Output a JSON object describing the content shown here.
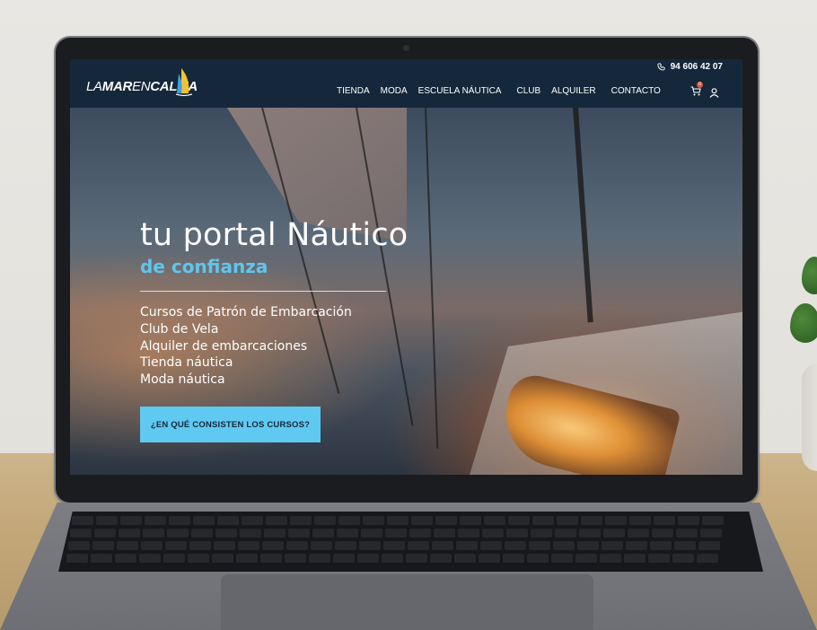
{
  "header": {
    "logo": {
      "part1": "LA",
      "part2": "MAR",
      "part3": "EN",
      "part4": "CALMA"
    },
    "phone": "94 606 42 07",
    "nav": [
      "TIENDA",
      "MODA",
      "ESCUELA NÁUTICA",
      "CLUB",
      "ALQUILER",
      "CONTACTO"
    ],
    "cart_count": "0",
    "icons": {
      "phone": "phone-icon",
      "cart": "cart-icon",
      "user": "user-icon"
    }
  },
  "hero": {
    "title_part1": "tu portal",
    "title_part2": "Náutico",
    "subtitle": "de confianza",
    "services": [
      "Cursos de Patrón de Embarcación",
      "Club de Vela",
      "Alquiler de embarcaciones",
      "Tienda náutica",
      "Moda náutica"
    ],
    "cta_label": "¿EN QUÉ CONSISTEN LOS CURSOS?"
  },
  "colors": {
    "header_bg": "#15273a",
    "accent": "#5ec6ee",
    "cta_bg": "#5fc9f1",
    "cart_badge": "#e5553b"
  }
}
